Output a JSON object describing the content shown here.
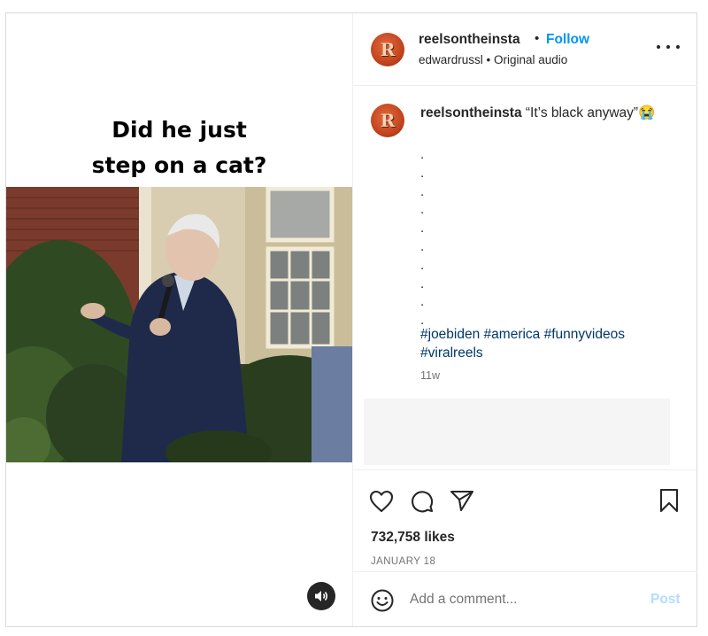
{
  "media": {
    "caption_line1": "Did he just",
    "caption_line2": "step on a cat?",
    "sound_icon": "speaker-icon"
  },
  "header": {
    "avatar_letter": "R",
    "username": "reelsontheinsta",
    "separator": "•",
    "follow_label": "Follow",
    "subtitle": "edwardrussl • Original audio",
    "more_icon": "more-horizontal-icon"
  },
  "caption": {
    "avatar_letter": "R",
    "username": "reelsontheinsta",
    "text": "“It’s black anyway”😭",
    "dots": [
      ".",
      ".",
      ".",
      ".",
      ".",
      ".",
      ".",
      ".",
      ".",
      "."
    ],
    "hashtags": [
      "#joebiden",
      "#america",
      "#funnyvideos",
      "#viralreels"
    ],
    "time_ago": "11w"
  },
  "actions": {
    "like_icon": "heart-icon",
    "comment_icon": "comment-icon",
    "share_icon": "paper-plane-icon",
    "save_icon": "bookmark-icon",
    "likes": "732,758 likes",
    "date": "JANUARY 18"
  },
  "add_comment": {
    "emoji_icon": "smiley-icon",
    "placeholder": "Add a comment...",
    "post_label": "Post"
  },
  "colors": {
    "follow": "#0095f6",
    "hashtag": "#00376b",
    "post_disabled": "#b3dbff",
    "secondary_text": "#737373",
    "avatar": "#c2441e"
  }
}
